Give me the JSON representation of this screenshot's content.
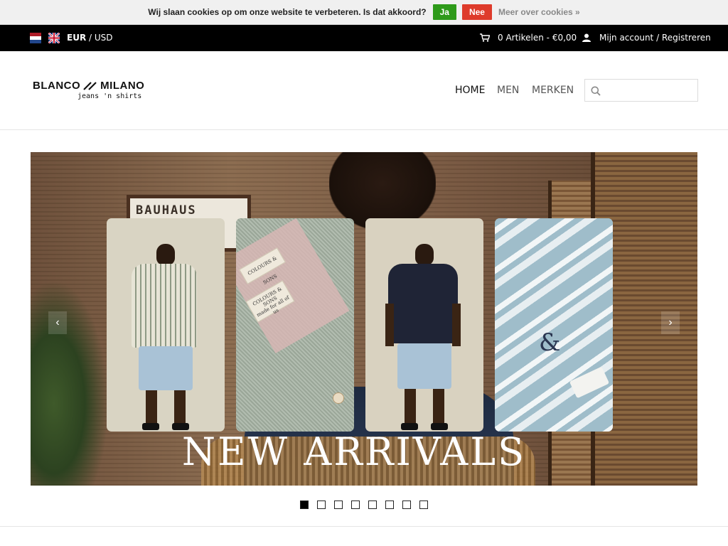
{
  "cookie_bar": {
    "message": "Wij slaan cookies op om onze website te verbeteren. Is dat akkoord?",
    "accept_label": "Ja",
    "decline_label": "Nee",
    "more_label": "Meer over cookies »",
    "accept_color": "#2e9a1a",
    "decline_color": "#de3b2b"
  },
  "topbar": {
    "languages": [
      "nl-flag-icon",
      "uk-flag-icon"
    ],
    "currency_active": "EUR",
    "currency_separator": " / ",
    "currency_other": "USD",
    "cart_label": "0 Artikelen - €0,00",
    "account_label": "Mijn account / Registreren"
  },
  "header": {
    "logo_left": "BLANCO",
    "logo_right": "MILANO",
    "logo_sub": "jeans 'n shirts",
    "nav": [
      "HOME",
      "MEN",
      "MERKEN"
    ],
    "search_placeholder": ""
  },
  "hero": {
    "poster_text": "BAUHAUS",
    "tag_line1": "COLOURS & SONS",
    "tag_line2": "made for all of us",
    "amp_mark": "&",
    "title": "NEW ARRIVALS",
    "slide_count": 8,
    "active_slide": 1
  }
}
